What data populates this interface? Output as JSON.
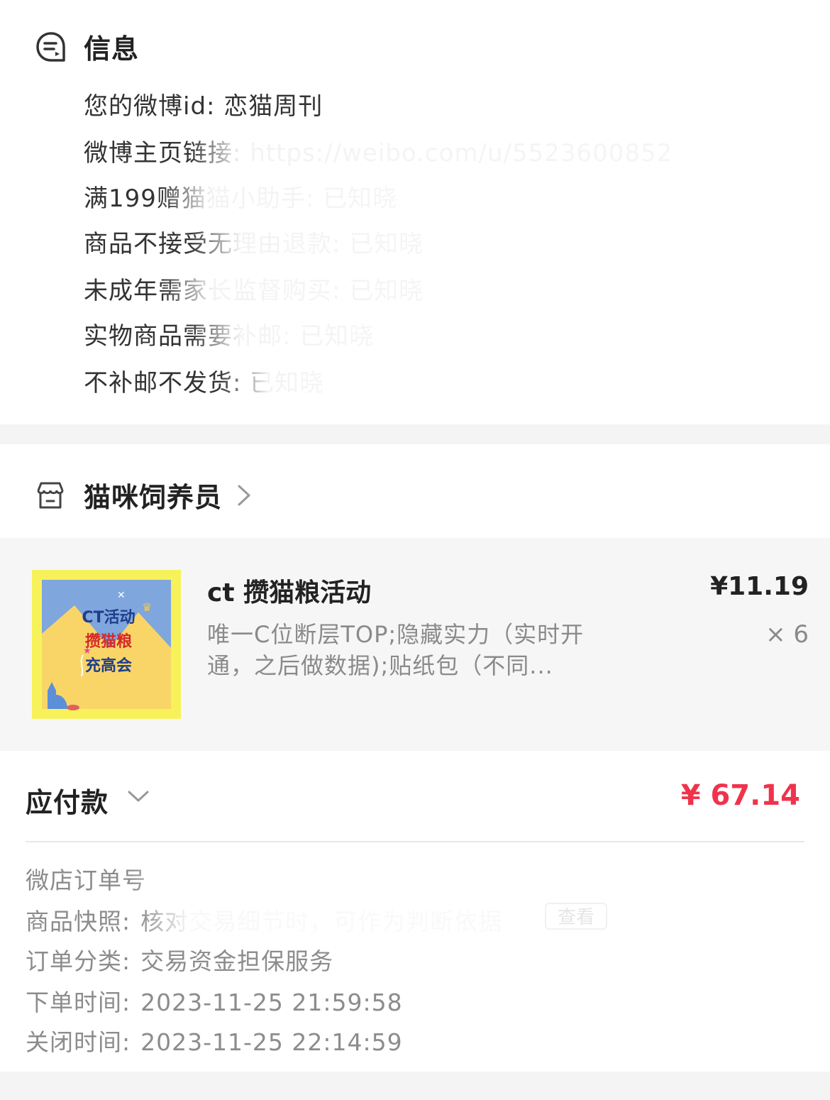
{
  "info": {
    "title": "信息",
    "lines": [
      "您的微博id: 恋猫周刊",
      "微博主页链接: https://weibo.com/u/5523600852",
      "满199赠猫猫小助手: 已知晓",
      "商品不接受无理由退款: 已知晓",
      "未成年需家长监督购买: 已知晓",
      "实物商品需要补邮: 已知晓",
      "不补邮不发货: 已知晓"
    ]
  },
  "shop": {
    "name": "猫咪饲养员",
    "icon": "store-icon"
  },
  "product": {
    "title": "ct 攒猫粮活动",
    "description": "唯一C位断层TOP;隐藏实力（实时开通，之后做数据);贴纸包（不同...",
    "price": "¥11.19",
    "quantity": "× 6",
    "image_text": [
      "CT活动",
      "攒猫粮",
      "充高会"
    ]
  },
  "payment": {
    "label": "应付款",
    "amount": "¥ 67.14"
  },
  "details": {
    "order_no_label": "微店订单号",
    "snapshot_label": "商品快照:",
    "snapshot_value": "核对交易细节时，可作为判断依据",
    "snapshot_button": "查看",
    "category_label": "订单分类:",
    "category_value": "交易资金担保服务",
    "created_label": "下单时间:",
    "created_value": "2023-11-25 21:59:58",
    "closed_label": "关闭时间:",
    "closed_value": "2023-11-25 22:14:59"
  },
  "colors": {
    "accent": "#f0334c",
    "section_bg": "#f6f6f6"
  }
}
